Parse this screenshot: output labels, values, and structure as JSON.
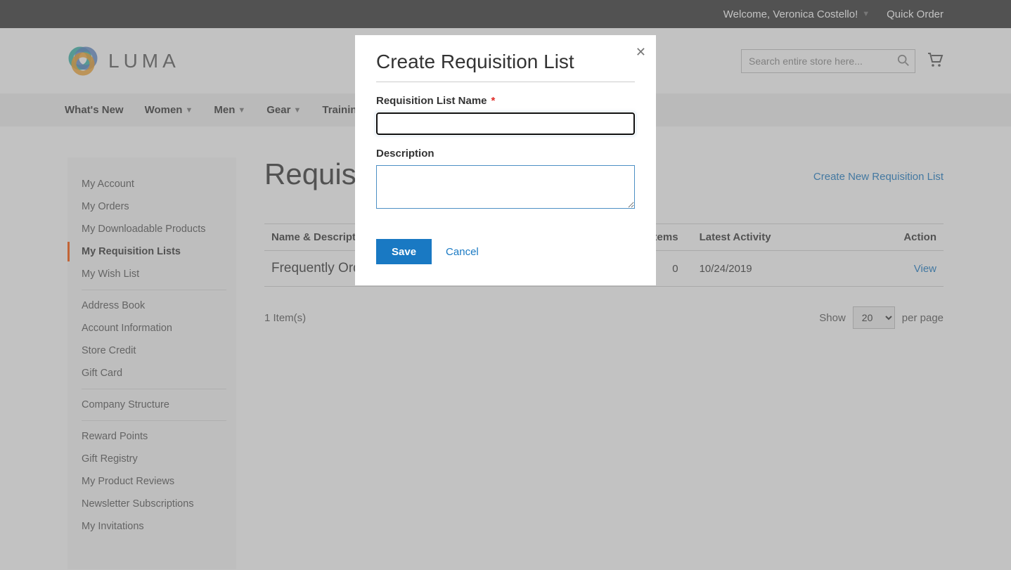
{
  "top_bar": {
    "welcome": "Welcome, Veronica Costello!",
    "quick_order": "Quick Order"
  },
  "logo": {
    "text": "LUMA"
  },
  "search": {
    "placeholder": "Search entire store here..."
  },
  "nav": [
    {
      "label": "What's New",
      "dropdown": false
    },
    {
      "label": "Women",
      "dropdown": true
    },
    {
      "label": "Men",
      "dropdown": true
    },
    {
      "label": "Gear",
      "dropdown": true
    },
    {
      "label": "Training",
      "dropdown": true
    }
  ],
  "sidebar": {
    "groups": [
      [
        "My Account",
        "My Orders",
        "My Downloadable Products",
        "My Requisition Lists",
        "My Wish List"
      ],
      [
        "Address Book",
        "Account Information",
        "Store Credit",
        "Gift Card"
      ],
      [
        "Company Structure"
      ],
      [
        "Reward Points",
        "Gift Registry",
        "My Product Reviews",
        "Newsletter Subscriptions",
        "My Invitations"
      ]
    ],
    "active": "My Requisition Lists"
  },
  "page": {
    "title": "Requisition Lists",
    "title_truncated": "Requisi",
    "create_link": "Create New Requisition List"
  },
  "table": {
    "headers": {
      "name": "Name & Description",
      "items": "Items",
      "latest": "Latest Activity",
      "action": "Action"
    },
    "rows": [
      {
        "name": "Frequently Ordered Products",
        "name_truncated": "Frequently Ord",
        "items": "0",
        "latest": "10/24/2019",
        "action": "View"
      }
    ]
  },
  "footer": {
    "count": "1 Item(s)",
    "show_label": "Show",
    "show_value": "20",
    "per_page": "per page"
  },
  "modal": {
    "title": "Create Requisition List",
    "name_label": "Requisition List Name",
    "name_value": "",
    "desc_label": "Description",
    "desc_value": "",
    "save": "Save",
    "cancel": "Cancel"
  }
}
